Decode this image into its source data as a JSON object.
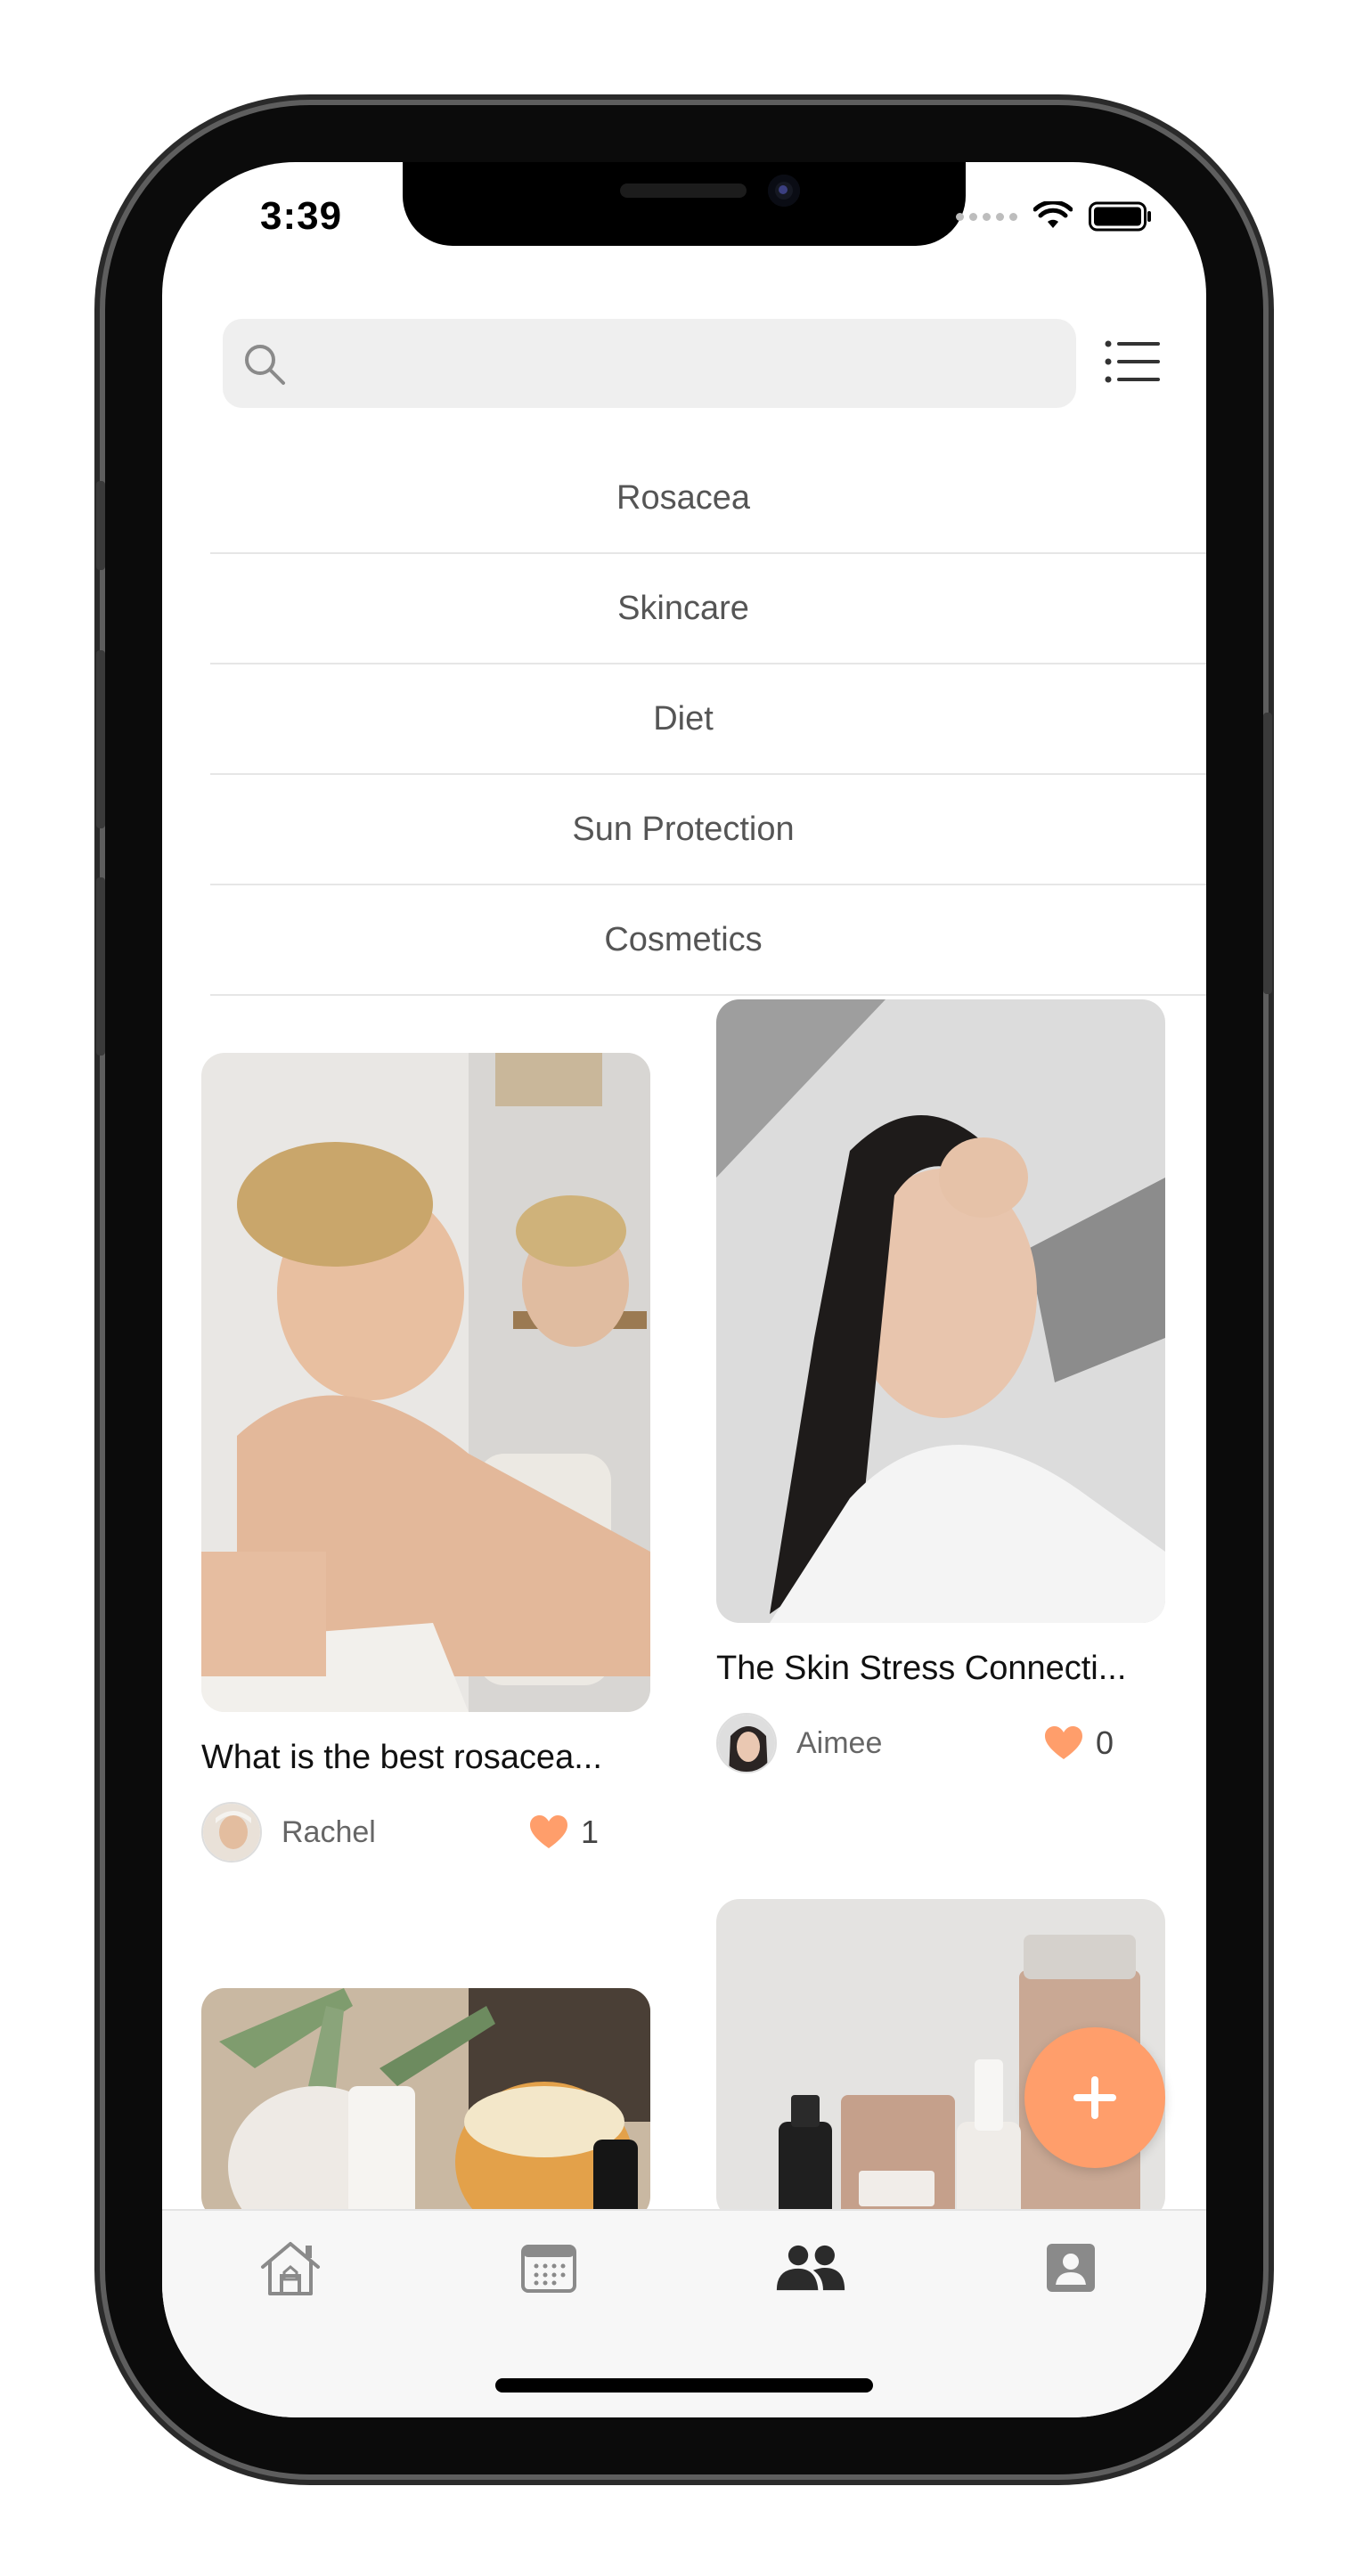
{
  "status_bar": {
    "time": "3:39"
  },
  "search": {
    "placeholder": "",
    "value": ""
  },
  "categories": [
    "Rosacea",
    "Skincare",
    "Diet",
    "Sun Protection",
    "Cosmetics"
  ],
  "posts": [
    {
      "title": "What is the best rosacea...",
      "author": "Rachel",
      "likes": "1"
    },
    {
      "title": "The Skin Stress Connecti...",
      "author": "Aimee",
      "likes": "0"
    }
  ],
  "icons": {
    "search": "search-icon",
    "filter": "list-icon",
    "like": "heart-icon",
    "add": "plus-icon",
    "tabs": [
      "home-icon",
      "calendar-icon",
      "community-icon",
      "profile-icon"
    ]
  },
  "colors": {
    "accent": "#ff9e6b",
    "active_tab": "#2b2b2b",
    "inactive_tab": "#8a8a8a"
  }
}
